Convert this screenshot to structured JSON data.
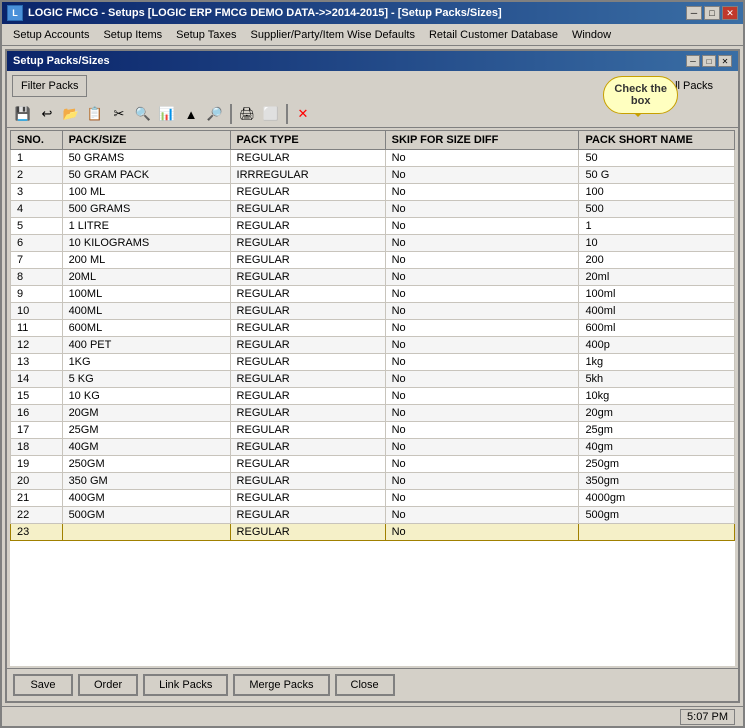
{
  "title": {
    "app": "LOGIC FMCG - Setups  [LOGIC ERP FMCG DEMO DATA->>2014-2015] - [Setup Packs/Sizes]",
    "icon": "L",
    "inner_title": "Setup Packs/Sizes"
  },
  "menu": {
    "items": [
      "Setup Accounts",
      "Setup Items",
      "Setup Taxes",
      "Supplier/Party/Item Wise Defaults",
      "Retail Customer Database",
      "Window"
    ]
  },
  "toolbar": {
    "filter_label": "Filter Packs",
    "all_packs_label": "All Packs",
    "tooltip": "Check the\nbox"
  },
  "table": {
    "headers": [
      "SNO.",
      "PACK/SIZE",
      "PACK TYPE",
      "SKIP FOR SIZE DIFF",
      "PACK SHORT NAME"
    ],
    "rows": [
      [
        "1",
        "50 GRAMS",
        "REGULAR",
        "No",
        "50"
      ],
      [
        "2",
        "50 GRAM PACK",
        "IRRREGULAR",
        "No",
        "50 G"
      ],
      [
        "3",
        "100 ML",
        "REGULAR",
        "No",
        "100"
      ],
      [
        "4",
        "500 GRAMS",
        "REGULAR",
        "No",
        "500"
      ],
      [
        "5",
        "1 LITRE",
        "REGULAR",
        "No",
        "1"
      ],
      [
        "6",
        "10 KILOGRAMS",
        "REGULAR",
        "No",
        "10"
      ],
      [
        "7",
        "200 ML",
        "REGULAR",
        "No",
        "200"
      ],
      [
        "8",
        "20ML",
        "REGULAR",
        "No",
        "20ml"
      ],
      [
        "9",
        "100ML",
        "REGULAR",
        "No",
        "100ml"
      ],
      [
        "10",
        "400ML",
        "REGULAR",
        "No",
        "400ml"
      ],
      [
        "11",
        "600ML",
        "REGULAR",
        "No",
        "600ml"
      ],
      [
        "12",
        "400 PET",
        "REGULAR",
        "No",
        "400p"
      ],
      [
        "13",
        "1KG",
        "REGULAR",
        "No",
        "1kg"
      ],
      [
        "14",
        "5 KG",
        "REGULAR",
        "No",
        "5kh"
      ],
      [
        "15",
        "10 KG",
        "REGULAR",
        "No",
        "10kg"
      ],
      [
        "16",
        "20GM",
        "REGULAR",
        "No",
        "20gm"
      ],
      [
        "17",
        "25GM",
        "REGULAR",
        "No",
        "25gm"
      ],
      [
        "18",
        "40GM",
        "REGULAR",
        "No",
        "40gm"
      ],
      [
        "19",
        "250GM",
        "REGULAR",
        "No",
        "250gm"
      ],
      [
        "20",
        "350 GM",
        "REGULAR",
        "No",
        "350gm"
      ],
      [
        "21",
        "400GM",
        "REGULAR",
        "No",
        "4000gm"
      ],
      [
        "22",
        "500GM",
        "REGULAR",
        "No",
        "500gm"
      ],
      [
        "23",
        "",
        "REGULAR",
        "No",
        ""
      ]
    ]
  },
  "buttons": {
    "save": "Save",
    "order": "Order",
    "link_packs": "Link Packs",
    "merge_packs": "Merge Packs",
    "close": "Close"
  },
  "status": {
    "time": "5:07 PM"
  },
  "title_controls": {
    "minimize": "─",
    "maximize": "□",
    "close": "✕"
  },
  "inner_controls": {
    "minimize": "─",
    "maximize": "□",
    "close": "✕"
  }
}
